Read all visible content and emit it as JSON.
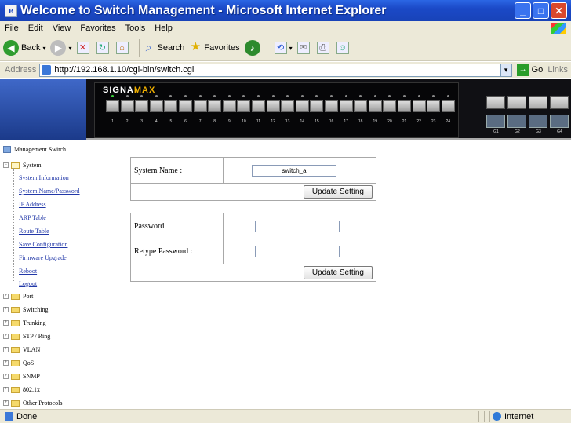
{
  "window": {
    "title": "Welcome to Switch Management - Microsoft Internet Explorer",
    "app_icon": "ie-page-icon"
  },
  "menu": [
    "File",
    "Edit",
    "View",
    "Favorites",
    "Tools",
    "Help"
  ],
  "toolbar": {
    "back_label": "Back",
    "search_label": "Search",
    "favorites_label": "Favorites"
  },
  "address": {
    "label": "Address",
    "url": "http://192.168.1.10/cgi-bin/switch.cgi",
    "go_label": "Go",
    "links_label": "Links"
  },
  "banner": {
    "brand_a": "SIGNA",
    "brand_b": "MAX",
    "port_numbers": [
      "1",
      "2",
      "3",
      "4",
      "5",
      "6",
      "7",
      "8",
      "9",
      "10",
      "11",
      "12",
      "13",
      "14",
      "15",
      "16",
      "17",
      "18",
      "19",
      "20",
      "21",
      "22",
      "23",
      "24"
    ],
    "uplink_numbers": [
      "G1",
      "G2",
      "G3",
      "G4"
    ]
  },
  "tree": {
    "root": "Management Switch",
    "system": "System",
    "system_items": [
      "System Information",
      "System Name/Password",
      "IP Address",
      "ARP Table",
      "Route Table",
      "Save Configuration",
      "Firmware Upgrade",
      "Reboot",
      "Logout"
    ],
    "other_nodes": [
      "Port",
      "Switching",
      "Trunking",
      "STP / Ring",
      "VLAN",
      "QoS",
      "SNMP",
      "802.1x",
      "Other Protocols"
    ]
  },
  "form1": {
    "label": "System Name :",
    "value": "switch_a",
    "button": "Update Setting"
  },
  "form2": {
    "password_label": "Password",
    "retype_label": "Retype Password :",
    "password_value": "",
    "retype_value": "",
    "button": "Update Setting"
  },
  "status": {
    "text": "Done",
    "zone": "Internet"
  },
  "colors": {
    "titlebar": "#1b49c7",
    "chrome": "#ece9d8",
    "link": "#2238a8",
    "tree_folder": "#f5d96b"
  }
}
